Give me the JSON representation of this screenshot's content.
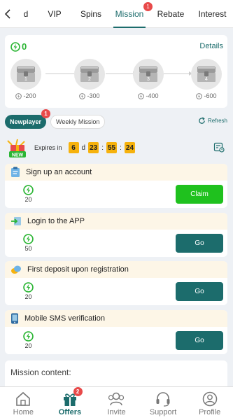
{
  "topbar": {
    "tabs": [
      {
        "label": "d"
      },
      {
        "label": "VIP"
      },
      {
        "label": "Spins"
      },
      {
        "label": "Mission",
        "badge": "1"
      },
      {
        "label": "Rebate"
      },
      {
        "label": "Interest"
      }
    ]
  },
  "progress": {
    "points": "0",
    "details_label": "Details",
    "chests": [
      {
        "num": "1",
        "value": "-200"
      },
      {
        "num": "2",
        "value": "-300"
      },
      {
        "num": "3",
        "value": "-400"
      },
      {
        "num": "4",
        "value": "-600"
      }
    ]
  },
  "mission_tabs": [
    {
      "label": "Newplayer",
      "badge": "1"
    },
    {
      "label": "Weekly Mission"
    }
  ],
  "refresh_label": "Refresh",
  "expires": {
    "label": "Expires in",
    "days": "6",
    "day_unit": "d",
    "hours": "23",
    "minutes": "55",
    "seconds": "24",
    "gift_tag": "NEW"
  },
  "missions": [
    {
      "title": "Sign up an account",
      "reward": "20",
      "button": "Claim"
    },
    {
      "title": "Login to the APP",
      "reward": "50",
      "button": "Go"
    },
    {
      "title": "First deposit upon registration",
      "reward": "20",
      "button": "Go"
    },
    {
      "title": "Mobile SMS verification",
      "reward": "20",
      "button": "Go"
    }
  ],
  "mission_content_label": "Mission content:",
  "bottomnav": {
    "items": [
      {
        "label": "Home"
      },
      {
        "label": "Offers",
        "badge": "2"
      },
      {
        "label": "Invite"
      },
      {
        "label": "Support"
      },
      {
        "label": "Profile"
      }
    ]
  },
  "colors": {
    "accent": "#1c6c6c",
    "claim": "#1fc11e",
    "badge": "#e84a4a",
    "timer": "#f6b20d"
  }
}
